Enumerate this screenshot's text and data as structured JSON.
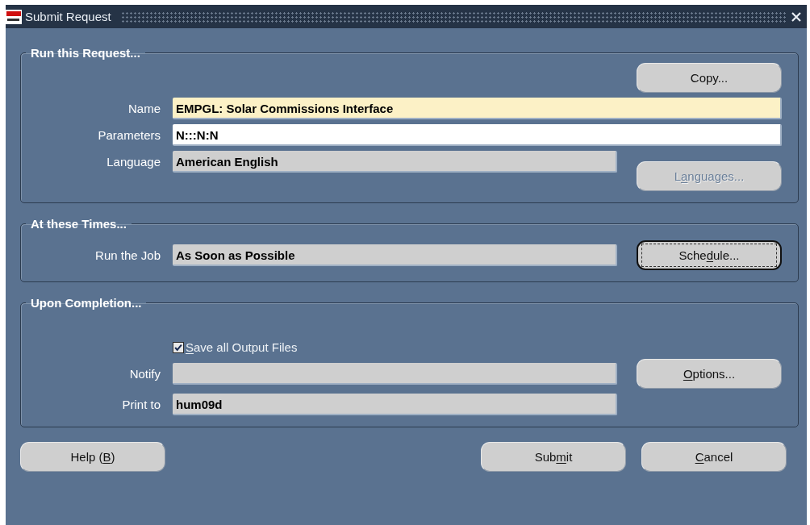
{
  "window": {
    "title": "Submit Request"
  },
  "groups": [
    {
      "title": "Run this Request...",
      "rows": [
        {
          "kind": "button",
          "button": {
            "label": "Copy...",
            "disabled": false,
            "focused": false
          },
          "overlap": false
        },
        {
          "kind": "required_field",
          "label": "Name",
          "value": "EMPGL: Solar Commissions Interface",
          "wide": true
        },
        {
          "kind": "text_field",
          "label": "Parameters",
          "value": "N:::N:N",
          "wide": true
        },
        {
          "kind": "readonly_field",
          "label": "Language",
          "value": "American English",
          "wide": false
        },
        {
          "kind": "button",
          "button": {
            "label": "L",
            "key": "a",
            "after": "nguages...",
            "disabled": true,
            "focused": false
          },
          "overlap": true
        }
      ]
    },
    {
      "title": "At these Times...",
      "rows": [
        {
          "kind": "readonly_field",
          "label": "Run the Job",
          "value": "As Soon as Possible",
          "wide": false,
          "button": {
            "label": "Sche",
            "key": "d",
            "after": "ule...",
            "disabled": false,
            "focused": true
          }
        }
      ]
    },
    {
      "title": "Upon Completion...",
      "rows": [
        {
          "kind": "checkbox",
          "key": "S",
          "after": "ave all Output Files",
          "checked": true
        },
        {
          "kind": "readonly_field",
          "label": "Notify",
          "wide": false,
          "button": {
            "key": "O",
            "after": "ptions...",
            "disabled": false,
            "focused": false
          }
        },
        {
          "kind": "readonly_field",
          "label": "Print to",
          "value": "hum09d",
          "wide": false
        }
      ]
    }
  ],
  "buttons": [
    {
      "label": "Help (",
      "key": "B",
      "after": ")",
      "disabled": false,
      "focused": false
    },
    {
      "label": "Sub",
      "key": "m",
      "after": "it",
      "disabled": false,
      "focused": false
    },
    {
      "key": "C",
      "after": "ancel",
      "disabled": false,
      "focused": false
    }
  ]
}
